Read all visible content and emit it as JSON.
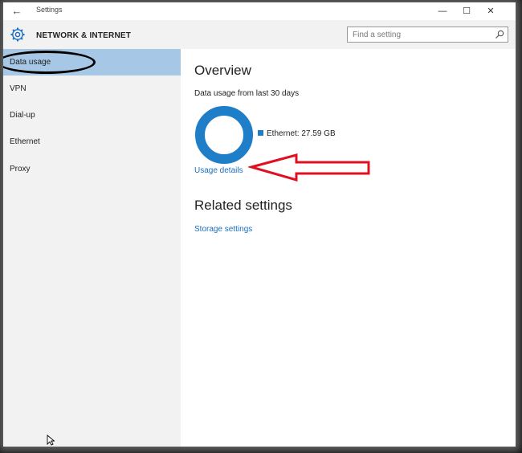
{
  "window": {
    "title": "Settings",
    "back_glyph": "←",
    "minimize_glyph": "—",
    "maximize_glyph": "☐",
    "close_glyph": "✕"
  },
  "header": {
    "title": "NETWORK & INTERNET",
    "icon": "gear-icon",
    "accent": "#1a6fc2"
  },
  "search": {
    "placeholder": "Find a setting",
    "value": "",
    "icon": "search-icon"
  },
  "sidebar": {
    "items": [
      {
        "label": "Data usage",
        "active": true
      },
      {
        "label": "VPN",
        "active": false
      },
      {
        "label": "Dial-up",
        "active": false
      },
      {
        "label": "Ethernet",
        "active": false
      },
      {
        "label": "Proxy",
        "active": false
      }
    ],
    "active_color": "#a6c8e6"
  },
  "overview": {
    "title": "Overview",
    "usage_label": "Data usage from last 30 days",
    "usage_details_link": "Usage details",
    "legend": {
      "label": "Ethernet: 27.59 GB",
      "color": "#1e7ec8"
    }
  },
  "chart_data": {
    "type": "pie",
    "categories": [
      "Ethernet"
    ],
    "values": [
      27.59
    ],
    "units": "GB"
  },
  "related": {
    "title": "Related settings",
    "storage_link": "Storage settings"
  },
  "annotations": {
    "highlight_color": "#000000",
    "arrow_color": "#e01020"
  }
}
